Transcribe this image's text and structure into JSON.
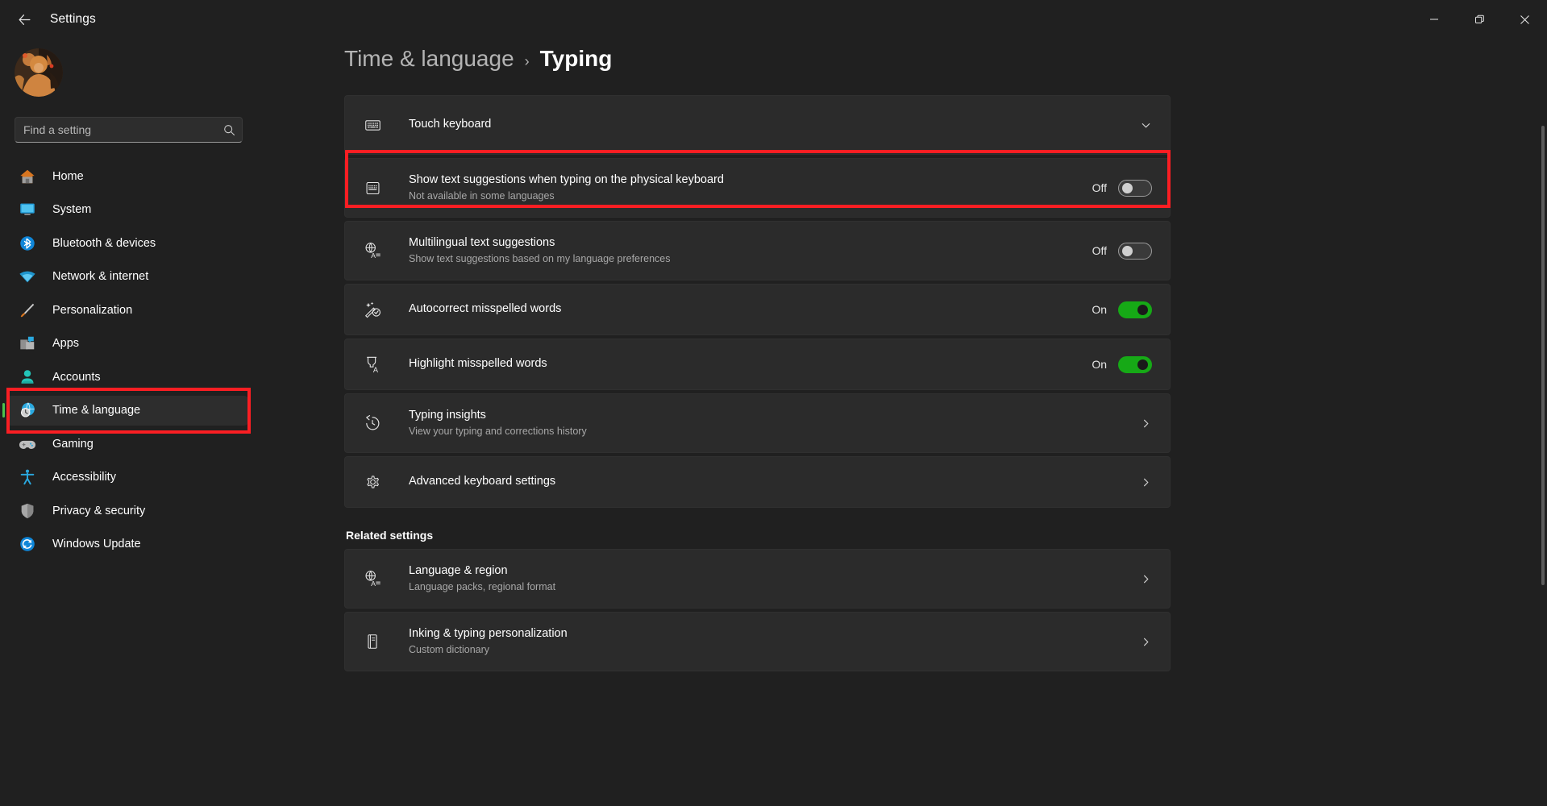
{
  "window": {
    "title": "Settings",
    "back_icon": "back-arrow-icon",
    "minimize_icon": "minimize-icon",
    "maximize_icon": "maximize-icon",
    "close_icon": "close-icon"
  },
  "sidebar": {
    "avatar_alt": "user-avatar",
    "search": {
      "placeholder": "Find a setting",
      "value": "",
      "icon": "search-icon"
    },
    "items": [
      {
        "label": "Home",
        "icon": "home-icon",
        "selected": false
      },
      {
        "label": "System",
        "icon": "system-icon",
        "selected": false
      },
      {
        "label": "Bluetooth & devices",
        "icon": "bluetooth-icon",
        "selected": false
      },
      {
        "label": "Network & internet",
        "icon": "network-icon",
        "selected": false
      },
      {
        "label": "Personalization",
        "icon": "paintbrush-icon",
        "selected": false
      },
      {
        "label": "Apps",
        "icon": "apps-icon",
        "selected": false
      },
      {
        "label": "Accounts",
        "icon": "accounts-icon",
        "selected": false
      },
      {
        "label": "Time & language",
        "icon": "time-language-icon",
        "selected": true
      },
      {
        "label": "Gaming",
        "icon": "gaming-icon",
        "selected": false
      },
      {
        "label": "Accessibility",
        "icon": "accessibility-icon",
        "selected": false
      },
      {
        "label": "Privacy & security",
        "icon": "shield-icon",
        "selected": false
      },
      {
        "label": "Windows Update",
        "icon": "windows-update-icon",
        "selected": false
      }
    ]
  },
  "breadcrumb": {
    "parent": "Time & language",
    "separator": "›",
    "current": "Typing"
  },
  "main": {
    "settings": [
      {
        "title": "Touch keyboard",
        "sub": "",
        "icon": "keyboard-icon",
        "control": "expander",
        "state": ""
      },
      {
        "title": "Show text suggestions when typing on the physical keyboard",
        "sub": "Not available in some languages",
        "icon": "keyboard-icon",
        "control": "toggle",
        "state": "Off",
        "on": false,
        "highlighted": true
      },
      {
        "title": "Multilingual text suggestions",
        "sub": "Show text suggestions based on my language preferences",
        "icon": "language-icon",
        "control": "toggle",
        "state": "Off",
        "on": false
      },
      {
        "title": "Autocorrect misspelled words",
        "sub": "",
        "icon": "autocorrect-icon",
        "control": "toggle",
        "state": "On",
        "on": true
      },
      {
        "title": "Highlight misspelled words",
        "sub": "",
        "icon": "highlighter-icon",
        "control": "toggle",
        "state": "On",
        "on": true
      },
      {
        "title": "Typing insights",
        "sub": "View your typing and corrections history",
        "icon": "history-icon",
        "control": "chevron",
        "state": ""
      },
      {
        "title": "Advanced keyboard settings",
        "sub": "",
        "icon": "gear-icon",
        "control": "chevron",
        "state": ""
      }
    ],
    "related_settings_heading": "Related settings",
    "related": [
      {
        "title": "Language & region",
        "sub": "Language packs, regional format",
        "icon": "language-icon",
        "control": "chevron"
      },
      {
        "title": "Inking & typing personalization",
        "sub": "Custom dictionary",
        "icon": "dictionary-icon",
        "control": "chevron"
      }
    ]
  },
  "annotations": {
    "color": "#fa1e23",
    "boxes": [
      "sidebar-time-language",
      "show-text-suggestions-row"
    ]
  }
}
